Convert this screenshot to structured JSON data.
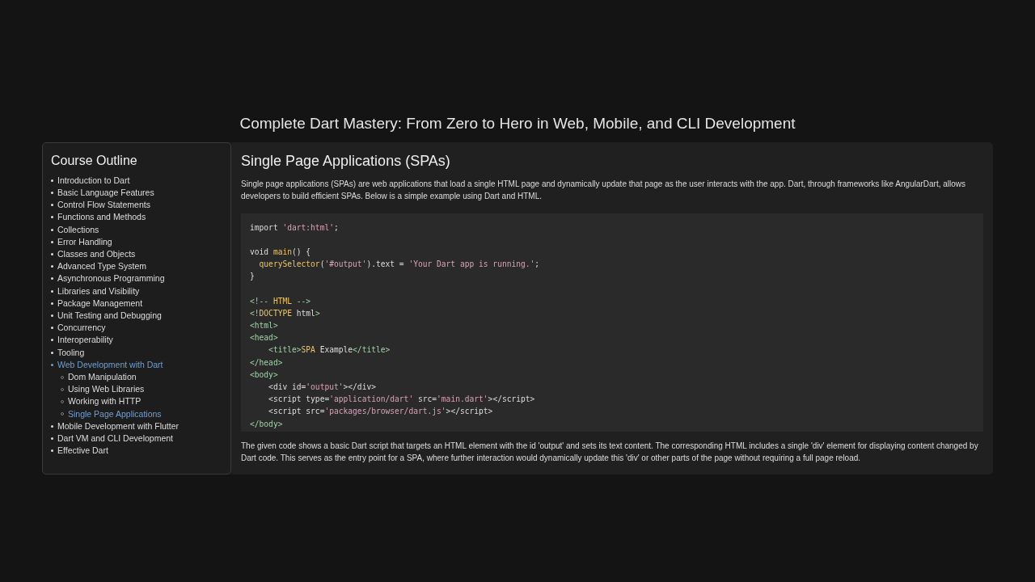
{
  "page_title": "Complete Dart Mastery: From Zero to Hero in Web, Mobile, and CLI Development",
  "sidebar": {
    "title": "Course Outline",
    "items": [
      {
        "label": "Introduction to Dart",
        "selected": false
      },
      {
        "label": "Basic Language Features",
        "selected": false
      },
      {
        "label": "Control Flow Statements",
        "selected": false
      },
      {
        "label": "Functions and Methods",
        "selected": false
      },
      {
        "label": "Collections",
        "selected": false
      },
      {
        "label": "Error Handling",
        "selected": false
      },
      {
        "label": "Classes and Objects",
        "selected": false
      },
      {
        "label": "Advanced Type System",
        "selected": false
      },
      {
        "label": "Asynchronous Programming",
        "selected": false
      },
      {
        "label": "Libraries and Visibility",
        "selected": false
      },
      {
        "label": "Package Management",
        "selected": false
      },
      {
        "label": "Unit Testing and Debugging",
        "selected": false
      },
      {
        "label": "Concurrency",
        "selected": false
      },
      {
        "label": "Interoperability",
        "selected": false
      },
      {
        "label": "Tooling",
        "selected": false
      },
      {
        "label": "Web Development with Dart",
        "selected": true,
        "children": [
          {
            "label": "Dom Manipulation",
            "selected": false
          },
          {
            "label": "Using Web Libraries",
            "selected": false
          },
          {
            "label": "Working with HTTP",
            "selected": false
          },
          {
            "label": "Single Page Applications",
            "selected": true
          }
        ]
      },
      {
        "label": "Mobile Development with Flutter",
        "selected": false
      },
      {
        "label": "Dart VM and CLI Development",
        "selected": false
      },
      {
        "label": "Effective Dart",
        "selected": false
      }
    ]
  },
  "content": {
    "heading": "Single Page Applications (SPAs)",
    "intro": "Single page applications (SPAs) are web applications that load a single HTML page and dynamically update that page as the user interacts with the app. Dart, through frameworks like AngularDart, allows developers to build efficient SPAs. Below is a simple example using Dart and HTML.",
    "code_lines": [
      [
        {
          "kind": "plain",
          "text": "import "
        },
        {
          "kind": "string",
          "text": "'dart:html'"
        },
        {
          "kind": "plain",
          "text": ";"
        }
      ],
      [
        {
          "kind": "blank"
        }
      ],
      [
        {
          "kind": "plain",
          "text": "void "
        },
        {
          "kind": "func",
          "text": "main"
        },
        {
          "kind": "plain",
          "text": "() {"
        }
      ],
      [
        {
          "kind": "func",
          "text": "  querySelector"
        },
        {
          "kind": "plain",
          "text": "("
        },
        {
          "kind": "string",
          "text": "'#output'"
        },
        {
          "kind": "plain",
          "text": ").text = "
        },
        {
          "kind": "string",
          "text": "'Your Dart app is running.'"
        },
        {
          "kind": "plain",
          "text": ";"
        }
      ],
      [
        {
          "kind": "plain",
          "text": "}"
        }
      ],
      [
        {
          "kind": "blank"
        }
      ],
      [
        {
          "kind": "tag",
          "text": "<!-- "
        },
        {
          "kind": "func",
          "text": "HTML"
        },
        {
          "kind": "tag",
          "text": " -->"
        }
      ],
      [
        {
          "kind": "tag",
          "text": "<!"
        },
        {
          "kind": "func",
          "text": "DOCTYPE"
        },
        {
          "kind": "plain",
          "text": " html"
        },
        {
          "kind": "tag",
          "text": ">"
        }
      ],
      [
        {
          "kind": "tag",
          "text": "<html>"
        }
      ],
      [
        {
          "kind": "tag",
          "text": "<head>"
        }
      ],
      [
        {
          "kind": "tag",
          "text": "    <title>"
        },
        {
          "kind": "func",
          "text": "SPA"
        },
        {
          "kind": "plain",
          "text": " Example"
        },
        {
          "kind": "tag",
          "text": "</title>"
        }
      ],
      [
        {
          "kind": "tag",
          "text": "</head>"
        }
      ],
      [
        {
          "kind": "tag",
          "text": "<body>"
        }
      ],
      [
        {
          "kind": "plain",
          "text": "    <div id="
        },
        {
          "kind": "string",
          "text": "'output'"
        },
        {
          "kind": "plain",
          "text": "></div>"
        }
      ],
      [
        {
          "kind": "plain",
          "text": "    <script type="
        },
        {
          "kind": "string",
          "text": "'application/dart'"
        },
        {
          "kind": "plain",
          "text": " src="
        },
        {
          "kind": "string",
          "text": "'main.dart'"
        },
        {
          "kind": "plain",
          "text": "></script>"
        }
      ],
      [
        {
          "kind": "plain",
          "text": "    <script src="
        },
        {
          "kind": "string",
          "text": "'packages/browser/dart.js'"
        },
        {
          "kind": "plain",
          "text": "></script>"
        }
      ],
      [
        {
          "kind": "tag",
          "text": "</body>"
        }
      ]
    ],
    "outro": "The given code shows a basic Dart script that targets an HTML element with the id 'output' and sets its text content. The corresponding HTML includes a single 'div' element for displaying content changed by Dart code. This serves as the entry point for a SPA, where further interaction would dynamically update this 'div' or other parts of the page without requiring a full page reload."
  }
}
